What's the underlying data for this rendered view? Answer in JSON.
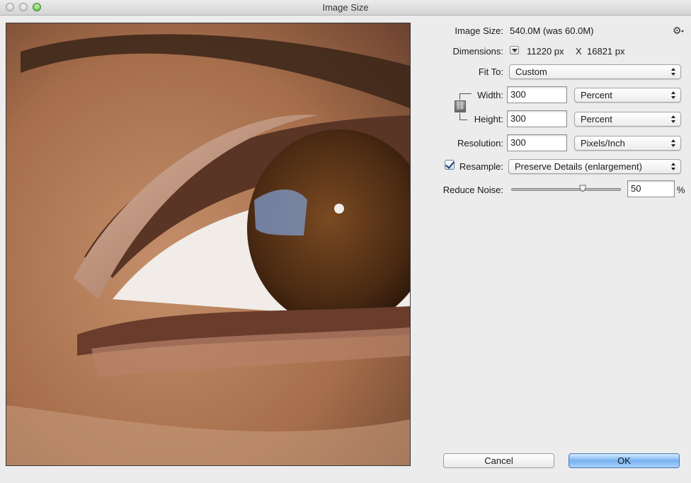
{
  "window": {
    "title": "Image Size"
  },
  "image_size": {
    "label": "Image Size:",
    "value": "540.0M (was 60.0M)"
  },
  "dimensions": {
    "label": "Dimensions:",
    "width": "11220 px",
    "x": "X",
    "height": "16821 px"
  },
  "fit_to": {
    "label": "Fit To:",
    "value": "Custom"
  },
  "width": {
    "label": "Width:",
    "value": "300",
    "unit": "Percent"
  },
  "height": {
    "label": "Height:",
    "value": "300",
    "unit": "Percent"
  },
  "resolution": {
    "label": "Resolution:",
    "value": "300",
    "unit": "Pixels/Inch"
  },
  "resample": {
    "label": "Resample:",
    "checked": true,
    "value": "Preserve Details (enlargement)"
  },
  "reduce_noise": {
    "label": "Reduce Noise:",
    "value": "50",
    "unit": "%",
    "slider_percent": 65
  },
  "buttons": {
    "cancel": "Cancel",
    "ok": "OK"
  },
  "icons": {
    "gear": "gear-icon",
    "link": "chain-link-icon"
  },
  "colors": {
    "ok_button": "#77b2f0",
    "window_bg": "#ececec"
  }
}
